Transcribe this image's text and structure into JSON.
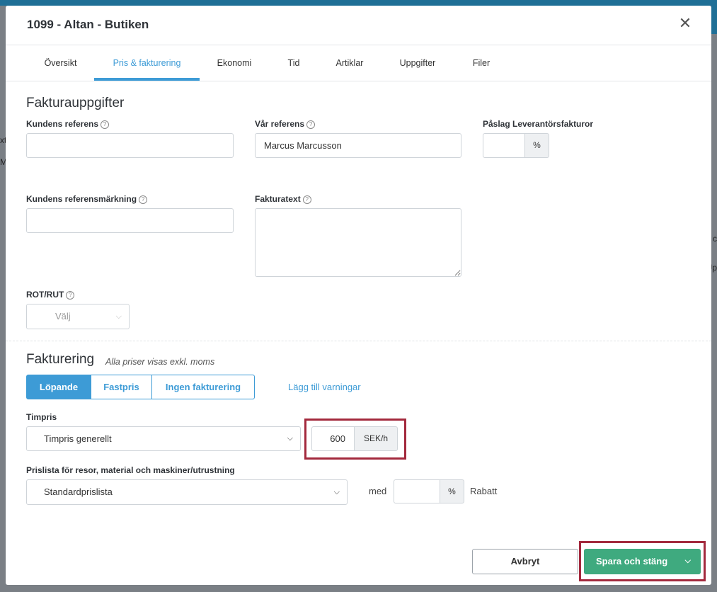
{
  "modal": {
    "title": "1099 - Altan - Butiken",
    "close_icon": "close-icon"
  },
  "tabs": [
    {
      "label": "Översikt"
    },
    {
      "label": "Pris & fakturering",
      "active": true
    },
    {
      "label": "Ekonomi"
    },
    {
      "label": "Tid"
    },
    {
      "label": "Artiklar"
    },
    {
      "label": "Uppgifter"
    },
    {
      "label": "Filer"
    }
  ],
  "fakturauppgifter": {
    "title": "Fakturauppgifter",
    "kundens_referens": {
      "label": "Kundens referens",
      "value": ""
    },
    "var_referens": {
      "label": "Vår referens",
      "value": "Marcus Marcusson"
    },
    "paslag": {
      "label": "Påslag Leverantörsfakturor",
      "value": "",
      "unit": "%"
    },
    "kundens_referensmarkning": {
      "label": "Kundens referensmärkning",
      "value": ""
    },
    "fakturatext": {
      "label": "Fakturatext",
      "value": ""
    },
    "rot_rut": {
      "label": "ROT/RUT",
      "selected": "Välj"
    }
  },
  "fakturering": {
    "title": "Fakturering",
    "subtitle": "Alla priser visas exkl. moms",
    "modes": [
      {
        "label": "Löpande",
        "active": true
      },
      {
        "label": "Fastpris"
      },
      {
        "label": "Ingen fakturering"
      }
    ],
    "add_warnings": "Lägg till varningar",
    "timpris": {
      "label": "Timpris",
      "selected": "Timpris generellt",
      "value": "600",
      "unit": "SEK/h"
    },
    "prislista": {
      "label": "Prislista för resor, material och maskiner/utrustning",
      "selected": "Standardprislista",
      "med": "med",
      "discount_value": "",
      "discount_unit": "%",
      "rabatt": "Rabatt"
    }
  },
  "footer": {
    "cancel": "Avbryt",
    "save": "Spara och stäng"
  },
  "background": {
    "left_chars": [
      "xt",
      "Ma"
    ],
    "right_chars": [
      "c",
      "Up"
    ]
  },
  "colors": {
    "accent": "#3d9bd6",
    "save": "#3faa7f",
    "highlight": "#a3293d"
  }
}
